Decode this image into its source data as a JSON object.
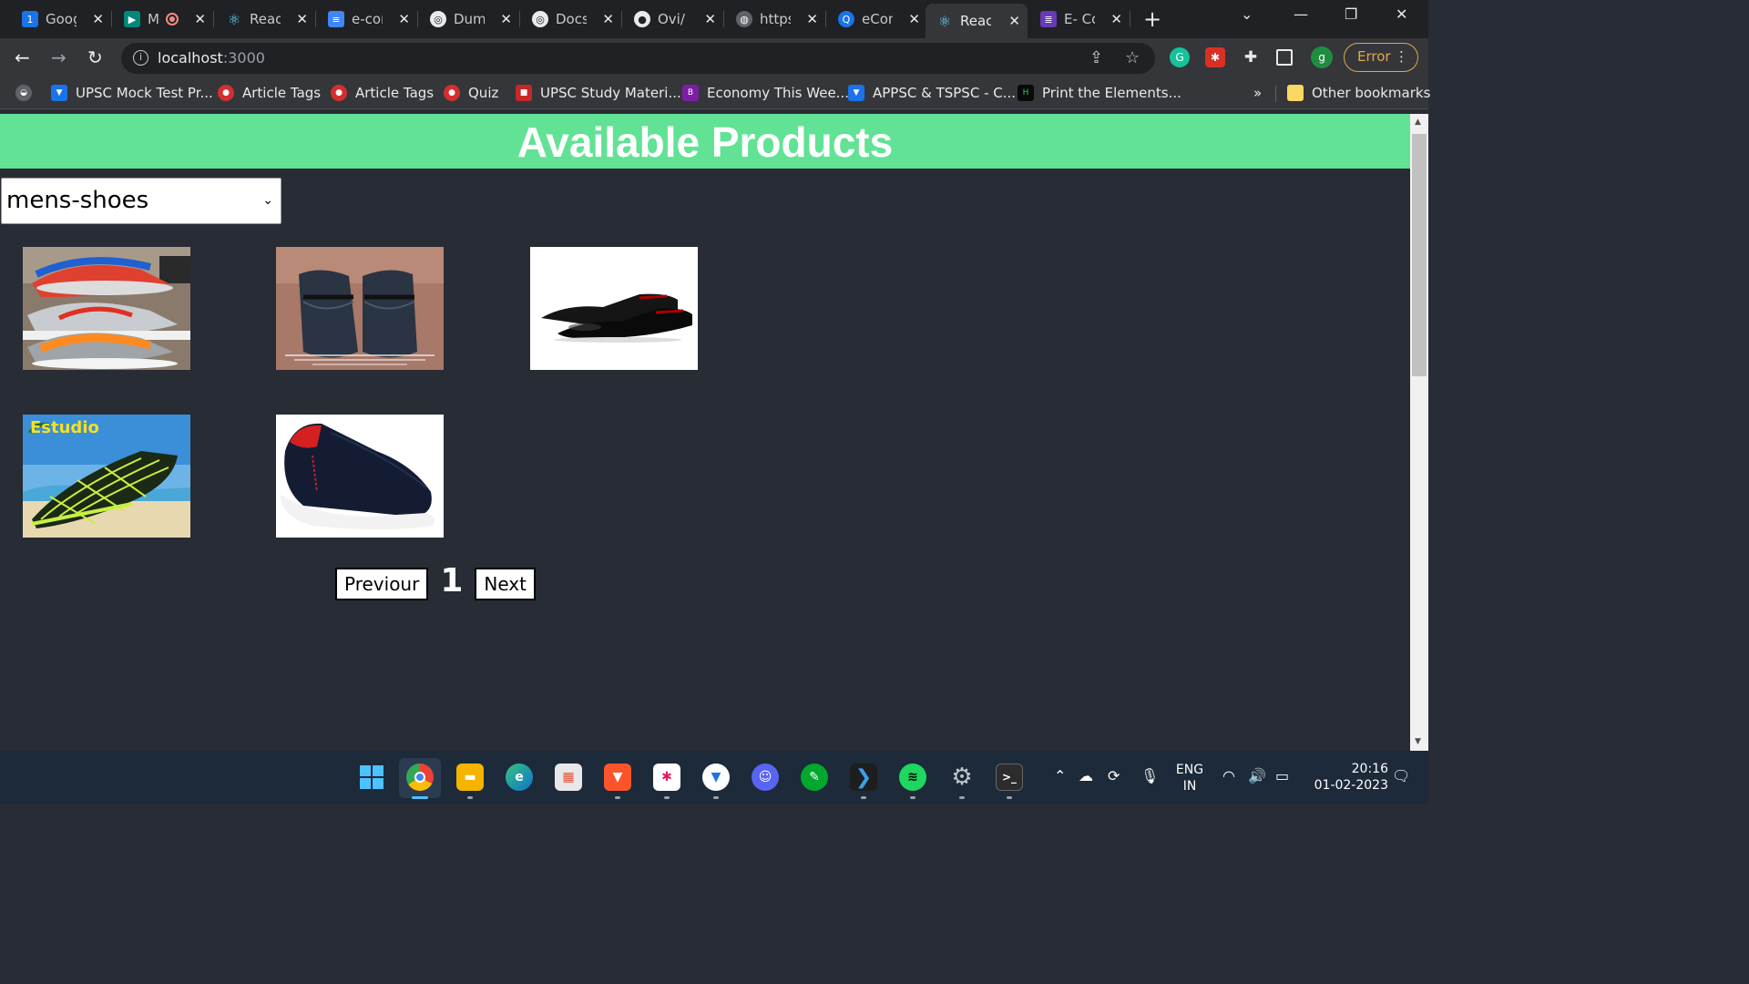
{
  "tabs": [
    {
      "title": "Google",
      "favicon_icon": "calendar-icon",
      "color": "#1a73e8"
    },
    {
      "title": "Meet",
      "favicon_icon": "meet-icon",
      "color": "#00897b"
    },
    {
      "title": "React App",
      "favicon_icon": "react-icon",
      "color": "#61dafb"
    },
    {
      "title": "e-commerce",
      "favicon_icon": "docs-icon",
      "color": "#4285f4"
    },
    {
      "title": "Dummy",
      "favicon_icon": "chatgpt-icon",
      "color": "#ffffff"
    },
    {
      "title": "Docs",
      "favicon_icon": "chatgpt-icon",
      "color": "#ffffff"
    },
    {
      "title": "Ovi/",
      "favicon_icon": "github-icon",
      "color": "#ffffff"
    },
    {
      "title": "https",
      "favicon_icon": "globe-icon",
      "color": "#9aa0a6"
    },
    {
      "title": "eCom",
      "favicon_icon": "search-icon",
      "color": "#1a73e8"
    },
    {
      "title": "React",
      "favicon_icon": "react-icon",
      "color": "#61dafb",
      "active": true
    },
    {
      "title": "E- Co",
      "favicon_icon": "forms-icon",
      "color": "#673ab7"
    }
  ],
  "address": {
    "host": "localhost",
    "port": ":3000"
  },
  "profile": {
    "initial": "g",
    "color": "#1e8e3e"
  },
  "error_label": "Error",
  "bookmarks": [
    {
      "label": "UPSC Mock Test Pr...",
      "icon": "testbook-icon",
      "color": "#1a73e8"
    },
    {
      "label": "Article Tags",
      "icon": "article-icon",
      "color": "#d32f2f"
    },
    {
      "label": "Article Tags",
      "icon": "article-icon",
      "color": "#d32f2f"
    },
    {
      "label": "Quiz",
      "icon": "quiz-icon",
      "color": "#d32f2f"
    },
    {
      "label": "UPSC Study Materi...",
      "icon": "study-icon",
      "color": "#c62828"
    },
    {
      "label": "Economy This Wee...",
      "icon": "economy-icon",
      "color": "#7b1fa2"
    },
    {
      "label": "APPSC & TSPSC - C...",
      "icon": "testbook-icon",
      "color": "#1a73e8"
    },
    {
      "label": "Print the Elements...",
      "icon": "hackerrank-icon",
      "color": "#0a0a0a"
    }
  ],
  "bookmarks_overflow": "»",
  "other_bookmarks": "Other bookmarks",
  "page": {
    "title": "Available Products",
    "category": "mens-shoes",
    "products": [
      {
        "name": "sneakers-image",
        "style": "sneakers"
      },
      {
        "name": "loafers-image",
        "style": "loafers"
      },
      {
        "name": "oxford-shoes-image",
        "style": "oxford"
      },
      {
        "name": "water-shoes-image",
        "style": "water"
      },
      {
        "name": "slip-on-shoes-image",
        "style": "slipon"
      }
    ],
    "pagination": {
      "previous": "Previour",
      "page": "1",
      "next": "Next"
    }
  },
  "taskbar": {
    "apps": [
      "windows-start-icon",
      "chrome-icon",
      "file-explorer-icon",
      "edge-icon",
      "store-icon",
      "brave-icon",
      "slack-icon",
      "testbook-icon",
      "discord-icon",
      "evernote-icon",
      "vscode-icon",
      "spotify-icon",
      "settings-icon",
      "terminal-icon"
    ],
    "language": [
      "ENG",
      "IN"
    ],
    "time": "20:16",
    "date": "01-02-2023"
  }
}
